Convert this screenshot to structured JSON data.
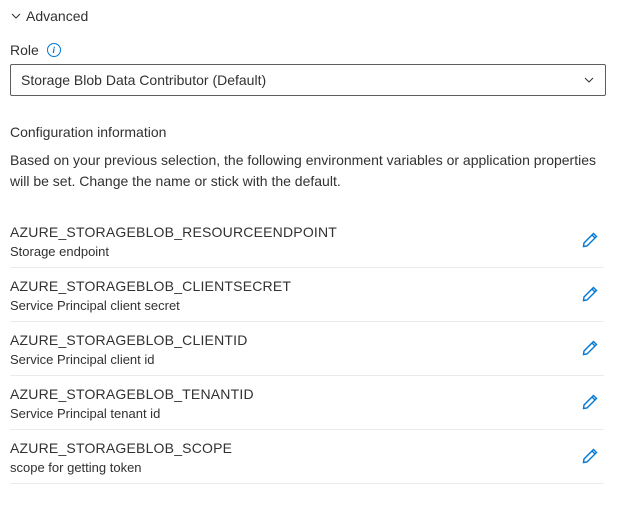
{
  "advanced": {
    "label": "Advanced"
  },
  "role": {
    "label": "Role",
    "selected": "Storage Blob Data Contributor (Default)"
  },
  "config": {
    "title": "Configuration information",
    "description": "Based on your previous selection, the following environment variables or application properties will be set. Change the name or stick with the default.",
    "items": [
      {
        "name": "AZURE_STORAGEBLOB_RESOURCEENDPOINT",
        "desc": "Storage endpoint"
      },
      {
        "name": "AZURE_STORAGEBLOB_CLIENTSECRET",
        "desc": "Service Principal client secret"
      },
      {
        "name": "AZURE_STORAGEBLOB_CLIENTID",
        "desc": "Service Principal client id"
      },
      {
        "name": "AZURE_STORAGEBLOB_TENANTID",
        "desc": "Service Principal tenant id"
      },
      {
        "name": "AZURE_STORAGEBLOB_SCOPE",
        "desc": "scope for getting token"
      }
    ]
  },
  "colors": {
    "accent": "#0078d4"
  }
}
